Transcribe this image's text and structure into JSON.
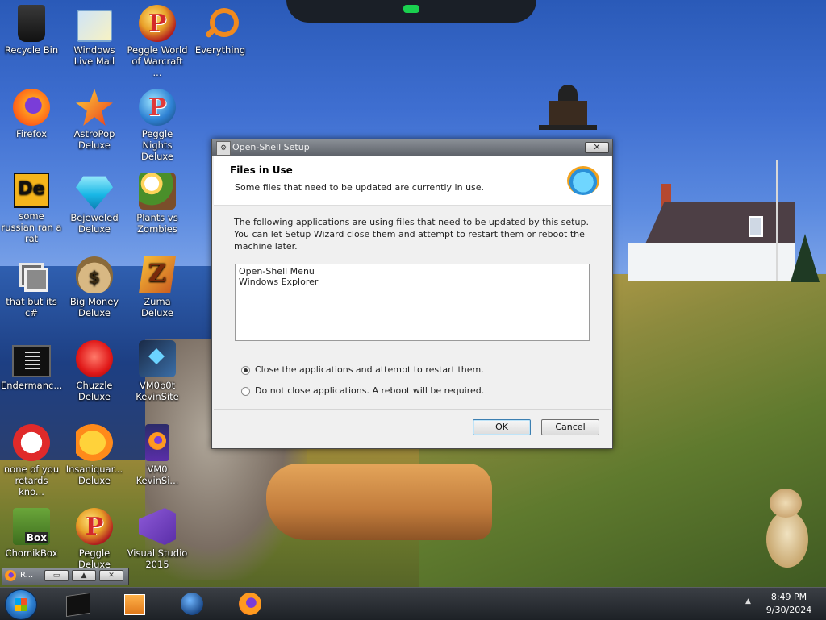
{
  "desktop_icons": [
    {
      "label": "Recycle Bin",
      "icon": "recycle-bin-icon"
    },
    {
      "label": "Windows Live Mail",
      "icon": "mail-icon"
    },
    {
      "label": "Peggle World of Warcraft ...",
      "icon": "peggle-icon"
    },
    {
      "label": "Everything",
      "icon": "magnifier-icon"
    },
    {
      "label": "Firefox",
      "icon": "firefox-icon"
    },
    {
      "label": "AstroPop Deluxe",
      "icon": "astropop-icon"
    },
    {
      "label": "Peggle Nights Deluxe",
      "icon": "peggle-nights-icon"
    },
    {
      "label": "some russian ran a rat",
      "icon": "de-icon"
    },
    {
      "label": "Bejeweled Deluxe",
      "icon": "gem-icon"
    },
    {
      "label": "Plants vs Zombies",
      "icon": "plants-vs-zombies-icon"
    },
    {
      "label": "that but its c#",
      "icon": "windows-icon"
    },
    {
      "label": "Big Money Deluxe",
      "icon": "money-bag-icon"
    },
    {
      "label": "Zuma Deluxe",
      "icon": "zuma-icon"
    },
    {
      "label": "Endermanc...",
      "icon": "terminal-icon"
    },
    {
      "label": "Chuzzle Deluxe",
      "icon": "chuzzle-icon"
    },
    {
      "label": "VM0b0t KevinSite",
      "icon": "vm-icon"
    },
    {
      "label": "none of you retards kno...",
      "icon": "rat-icon"
    },
    {
      "label": "Insaniquar... Deluxe",
      "icon": "fish-icon"
    },
    {
      "label": "VM0 KevinSi...",
      "icon": "vm-firefox-icon"
    },
    {
      "label": "ChomikBox",
      "icon": "chomikbox-icon"
    },
    {
      "label": "Peggle Deluxe",
      "icon": "peggle-deluxe-icon"
    },
    {
      "label": "Visual Studio 2015",
      "icon": "visual-studio-icon"
    }
  ],
  "dialog": {
    "title": "Open-Shell Setup",
    "close_label": "✕",
    "header_title": "Files in Use",
    "header_subtitle": "Some files that need to be updated are currently in use.",
    "body_text": "The following applications are using files that need to be updated by this setup. You can let Setup Wizard close them and attempt to restart them or reboot the machine later.",
    "apps": [
      "Open-Shell Menu",
      "Windows Explorer"
    ],
    "options": [
      {
        "label": "Close the applications and attempt to restart them.",
        "selected": true
      },
      {
        "label": "Do not close applications. A reboot will be required.",
        "selected": false
      }
    ],
    "ok_label": "OK",
    "cancel_label": "Cancel"
  },
  "mini_window": {
    "label": "R...",
    "restore_label": "▭",
    "maximize_label": "▲",
    "close_label": "✕"
  },
  "taskbar": {
    "tray_arrow": "▲",
    "time": "8:49 PM",
    "date": "9/30/2024"
  }
}
